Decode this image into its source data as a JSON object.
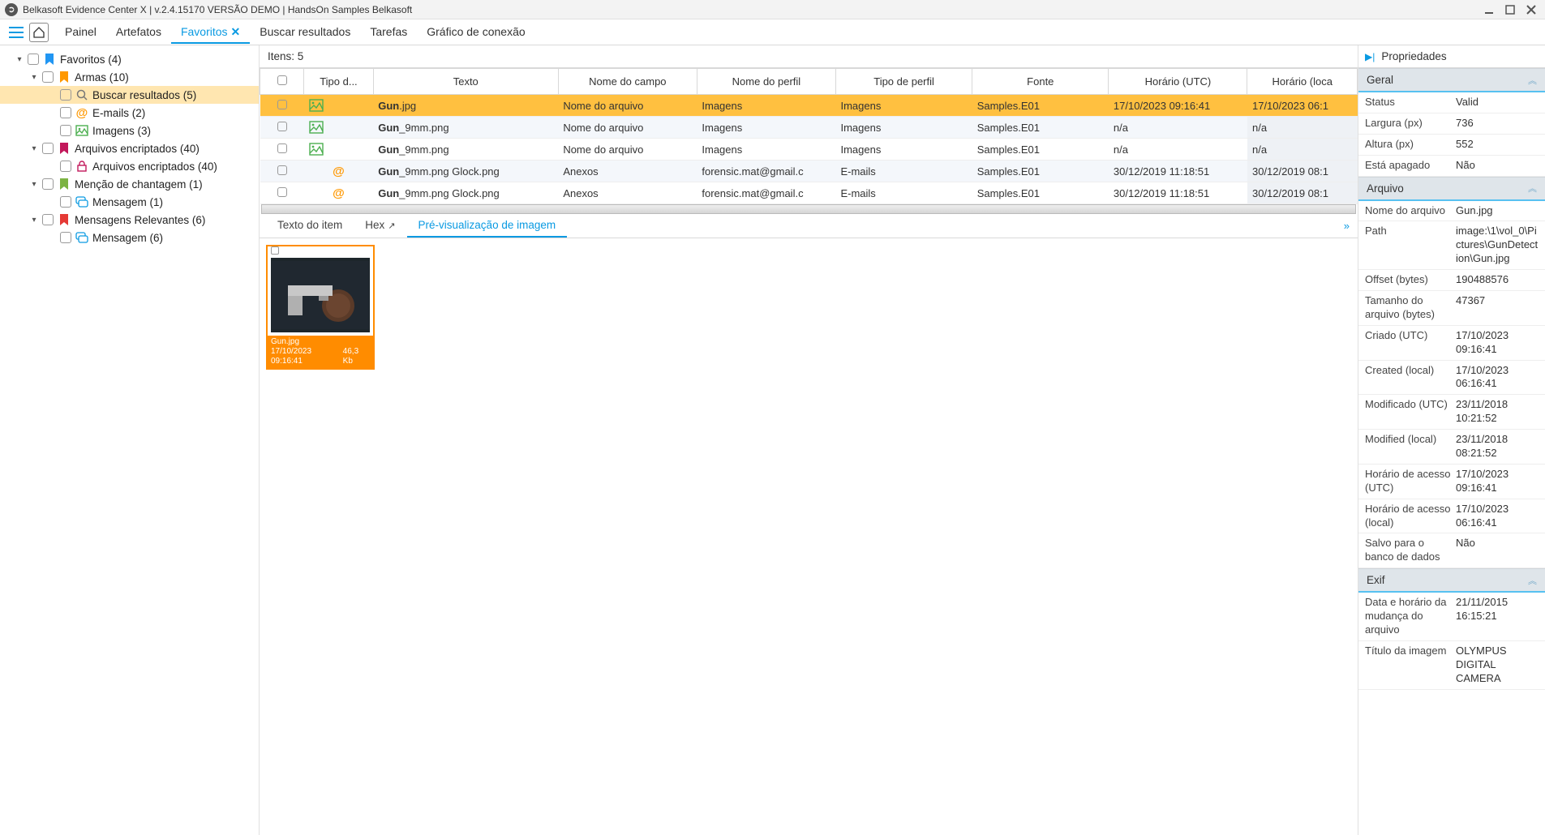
{
  "window": {
    "title": "Belkasoft Evidence Center X | v.2.4.15170 VERSÃO DEMO | HandsOn Samples Belkasoft"
  },
  "menu": {
    "items": [
      "Painel",
      "Artefatos",
      "Favoritos",
      "Buscar resultados",
      "Tarefas",
      "Gráfico de conexão"
    ],
    "active": 2
  },
  "tree": [
    {
      "level": 0,
      "expandable": true,
      "icon": "bookmark-blue",
      "color": "#2196f3",
      "label": "Favoritos (4)"
    },
    {
      "level": 1,
      "expandable": true,
      "icon": "bookmark-orange",
      "color": "#ff9800",
      "label": "Armas (10)"
    },
    {
      "level": 2,
      "expandable": false,
      "icon": "search-icon",
      "color": "#777",
      "label": "Buscar resultados (5)",
      "selected": true
    },
    {
      "level": 2,
      "expandable": false,
      "icon": "at-icon",
      "color": "#ff9800",
      "label": "E-mails (2)"
    },
    {
      "level": 2,
      "expandable": false,
      "icon": "image-icon",
      "color": "#4caf50",
      "label": "Imagens (3)"
    },
    {
      "level": 1,
      "expandable": true,
      "icon": "bookmark-purple",
      "color": "#c2185b",
      "label": "Arquivos encriptados (40)"
    },
    {
      "level": 2,
      "expandable": false,
      "icon": "lock-icon",
      "color": "#c2185b",
      "label": "Arquivos encriptados (40)"
    },
    {
      "level": 1,
      "expandable": true,
      "icon": "bookmark-green",
      "color": "#7cb342",
      "label": "Menção de chantagem (1)"
    },
    {
      "level": 2,
      "expandable": false,
      "icon": "chat-icon",
      "color": "#0a9ae2",
      "label": "Mensagem (1)"
    },
    {
      "level": 1,
      "expandable": true,
      "icon": "bookmark-red",
      "color": "#e53935",
      "label": "Mensagens Relevantes (6)"
    },
    {
      "level": 2,
      "expandable": false,
      "icon": "chat-icon",
      "color": "#0a9ae2",
      "label": "Mensagem (6)"
    }
  ],
  "items_header": "Itens: 5",
  "columns": [
    "",
    "Tipo d...",
    "Texto",
    "Nome do campo",
    "Nome do perfil",
    "Tipo de perfil",
    "Fonte",
    "Horário (UTC)",
    "Horário (loca"
  ],
  "rows": [
    {
      "icon": "image",
      "text_b": "Gun",
      "text_r": ".jpg",
      "campo": "Nome do arquivo",
      "perfil": "Imagens",
      "tipo": "Imagens",
      "fonte": "Samples.E01",
      "utc": "17/10/2023 09:16:41",
      "loc": "17/10/2023 06:1",
      "sel": true
    },
    {
      "icon": "image",
      "text_b": "Gun",
      "text_r": "_9mm.png",
      "campo": "Nome do arquivo",
      "perfil": "Imagens",
      "tipo": "Imagens",
      "fonte": "Samples.E01",
      "utc": "n/a",
      "loc": "n/a"
    },
    {
      "icon": "image",
      "text_b": "Gun",
      "text_r": "_9mm.png",
      "campo": "Nome do arquivo",
      "perfil": "Imagens",
      "tipo": "Imagens",
      "fonte": "Samples.E01",
      "utc": "n/a",
      "loc": "n/a"
    },
    {
      "icon": "at",
      "text_b": "Gun",
      "text_r": "_9mm.png  Glock.png",
      "campo": "Anexos",
      "perfil": "forensic.mat@gmail.c",
      "tipo": "E-mails",
      "fonte": "Samples.E01",
      "utc": "30/12/2019 11:18:51",
      "loc": "30/12/2019 08:1"
    },
    {
      "icon": "at",
      "text_b": "Gun",
      "text_r": "_9mm.png  Glock.png",
      "campo": "Anexos",
      "perfil": "forensic.mat@gmail.c",
      "tipo": "E-mails",
      "fonte": "Samples.E01",
      "utc": "30/12/2019 11:18:51",
      "loc": "30/12/2019 08:1"
    }
  ],
  "preview_tabs": {
    "items": [
      "Texto do item",
      "Hex",
      "Pré-visualização de imagem"
    ],
    "active": 2
  },
  "thumb": {
    "name": "Gun.jpg",
    "time": "17/10/2023 09:16:41",
    "size": "46,3 Kb"
  },
  "props_title": "Propriedades",
  "sections": {
    "geral": {
      "title": "Geral",
      "rows": [
        {
          "k": "Status",
          "v": "Valid"
        },
        {
          "k": "Largura (px)",
          "v": "736"
        },
        {
          "k": "Altura (px)",
          "v": "552"
        },
        {
          "k": "Está apagado",
          "v": "Não"
        }
      ]
    },
    "arquivo": {
      "title": "Arquivo",
      "rows": [
        {
          "k": "Nome do arquivo",
          "v": "Gun.jpg"
        },
        {
          "k": "Path",
          "v": "image:\\1\\vol_0\\Pictures\\GunDetection\\Gun.jpg"
        },
        {
          "k": "Offset (bytes)",
          "v": "190488576"
        },
        {
          "k": "Tamanho do arquivo (bytes)",
          "v": "47367"
        },
        {
          "k": "Criado (UTC)",
          "v": "17/10/2023 09:16:41"
        },
        {
          "k": "Created (local)",
          "v": "17/10/2023 06:16:41"
        },
        {
          "k": "Modificado (UTC)",
          "v": "23/11/2018 10:21:52"
        },
        {
          "k": "Modified (local)",
          "v": "23/11/2018 08:21:52"
        },
        {
          "k": "Horário de acesso (UTC)",
          "v": "17/10/2023 09:16:41"
        },
        {
          "k": "Horário de acesso (local)",
          "v": "17/10/2023 06:16:41"
        },
        {
          "k": "Salvo para o banco de dados",
          "v": "Não"
        }
      ]
    },
    "exif": {
      "title": "Exif",
      "rows": [
        {
          "k": "Data e horário da mudança do arquivo",
          "v": "21/11/2015 16:15:21"
        },
        {
          "k": "Título da imagem",
          "v": "OLYMPUS DIGITAL CAMERA"
        }
      ]
    }
  }
}
